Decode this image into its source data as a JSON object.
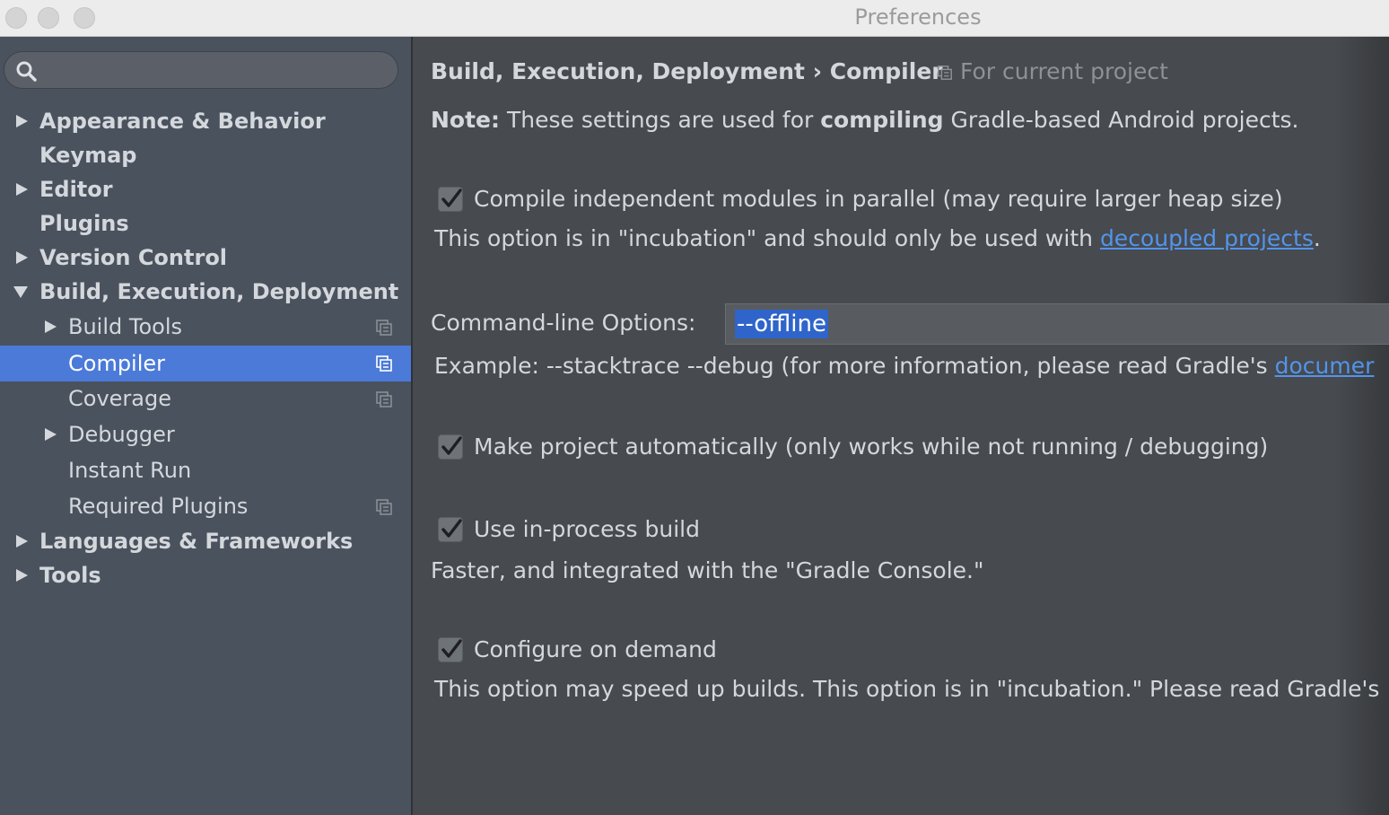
{
  "window": {
    "title": "Preferences"
  },
  "sidebar": {
    "search_placeholder": "",
    "items": [
      {
        "label": "Appearance & Behavior"
      },
      {
        "label": "Keymap"
      },
      {
        "label": "Editor"
      },
      {
        "label": "Plugins"
      },
      {
        "label": "Version Control"
      },
      {
        "label": "Build, Execution, Deployment"
      },
      {
        "label": "Build Tools"
      },
      {
        "label": "Compiler"
      },
      {
        "label": "Coverage"
      },
      {
        "label": "Debugger"
      },
      {
        "label": "Instant Run"
      },
      {
        "label": "Required Plugins"
      },
      {
        "label": "Languages & Frameworks"
      },
      {
        "label": "Tools"
      }
    ]
  },
  "header": {
    "breadcrumb_parent": "Build, Execution, Deployment",
    "separator": "›",
    "breadcrumb_current": "Compiler",
    "scope": "For current project"
  },
  "note": {
    "label": "Note:",
    "text_before": "These settings are used for",
    "emphasis": "compiling",
    "text_after": "Gradle-based Android projects."
  },
  "options": {
    "parallel": {
      "checked": true,
      "label": "Compile independent modules in parallel (may require larger heap size)",
      "help_text": "This option is in \"incubation\" and should only be used with",
      "help_link": "decoupled projects",
      "help_end": "."
    },
    "cmdline": {
      "label": "Command-line Options:",
      "value": "--offline",
      "example_text": "Example: --stacktrace --debug (for more information, please read Gradle's",
      "example_link": "documer"
    },
    "make_auto": {
      "checked": true,
      "label": "Make project automatically (only works while not running / debugging)"
    },
    "in_process": {
      "checked": true,
      "label": "Use in-process build",
      "help_text": "Faster, and integrated with the \"Gradle Console.\""
    },
    "configure_demand": {
      "checked": true,
      "label": "Configure on demand",
      "help_text": "This option may speed up builds. This option is in \"incubation.\" Please read Gradle's"
    }
  },
  "colors": {
    "selection": "#4b7ad8",
    "link": "#5394ec",
    "sidebar_bg": "#4a525e",
    "content_bg": "#474a4e"
  }
}
